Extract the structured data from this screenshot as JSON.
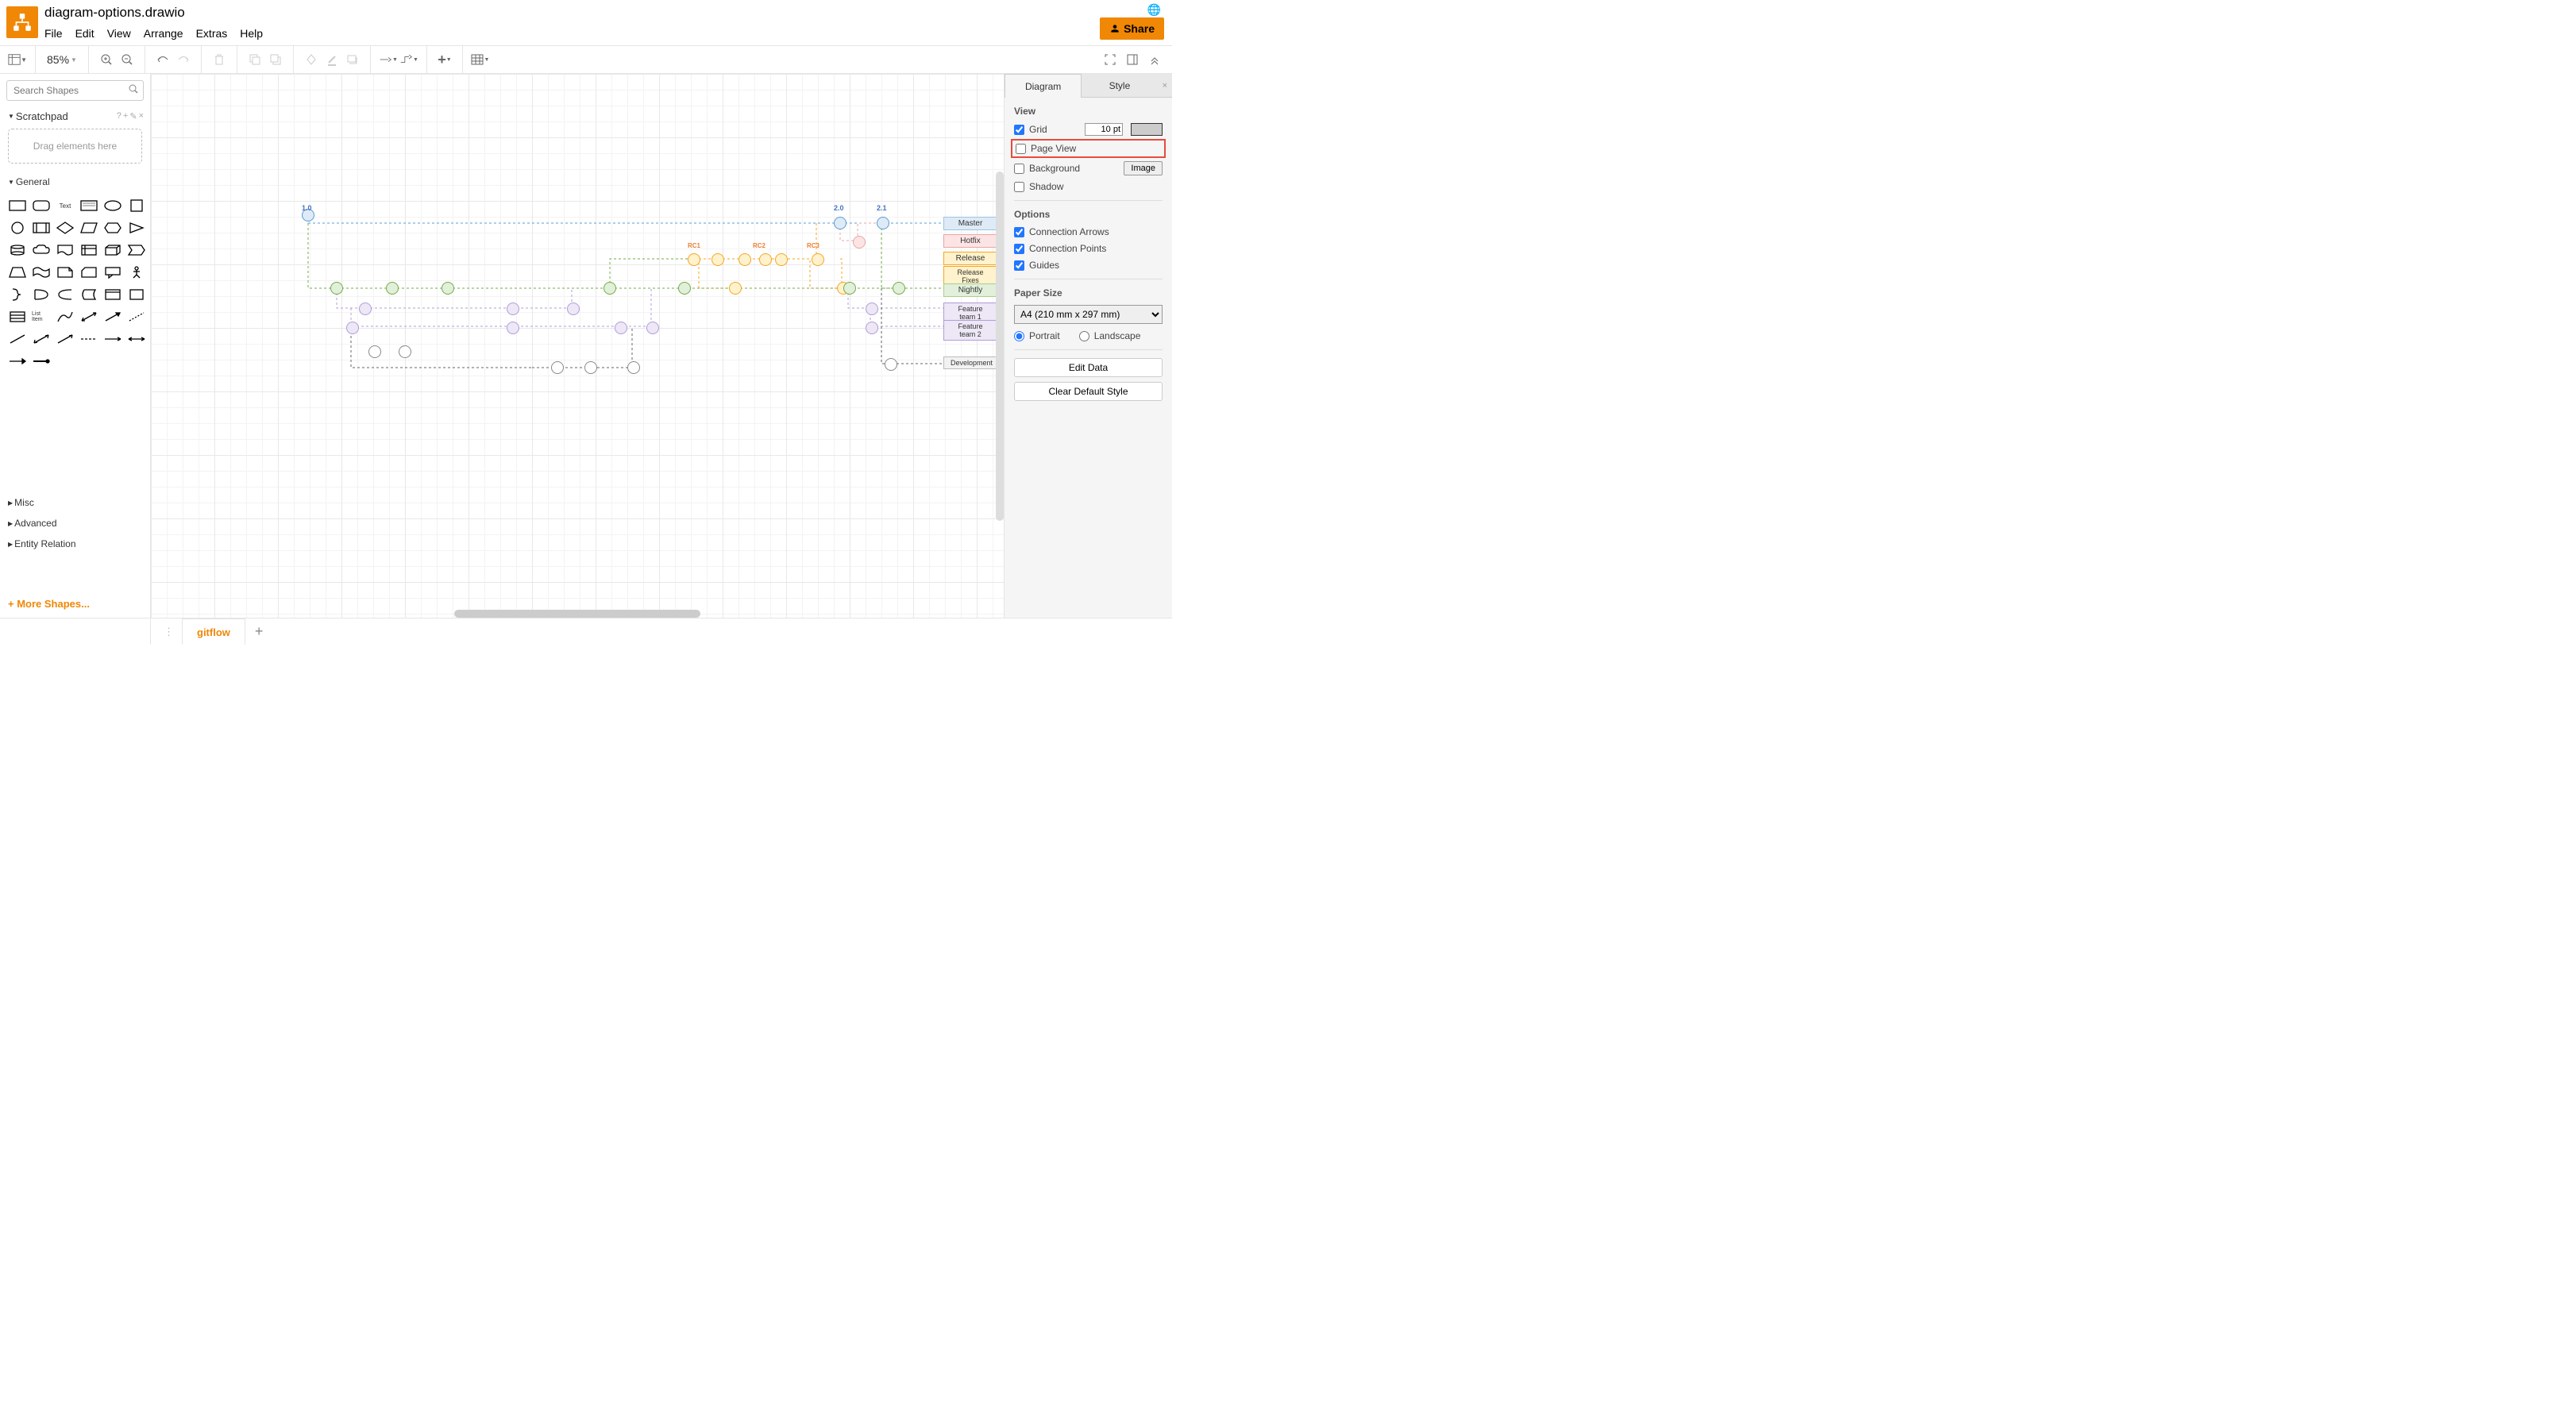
{
  "filename": "diagram-options.drawio",
  "menubar": [
    "File",
    "Edit",
    "View",
    "Arrange",
    "Extras",
    "Help"
  ],
  "share_label": "Share",
  "zoom": "85%",
  "search_placeholder": "Search Shapes",
  "scratchpad": {
    "title": "Scratchpad",
    "hint": "Drag elements here"
  },
  "shape_sections": {
    "general": "General",
    "misc": "Misc",
    "advanced": "Advanced",
    "entity": "Entity Relation"
  },
  "more_shapes": "+ More Shapes...",
  "page_tab": "gitflow",
  "right_tabs": {
    "diagram": "Diagram",
    "style": "Style"
  },
  "panel": {
    "view_title": "View",
    "grid": "Grid",
    "grid_value": "10 pt",
    "page_view": "Page View",
    "background": "Background",
    "image_btn": "Image",
    "shadow": "Shadow",
    "options_title": "Options",
    "conn_arrows": "Connection Arrows",
    "conn_points": "Connection Points",
    "guides": "Guides",
    "paper_title": "Paper Size",
    "paper_value": "A4 (210 mm x 297 mm)",
    "portrait": "Portrait",
    "landscape": "Landscape",
    "edit_data": "Edit Data",
    "clear_style": "Clear Default Style"
  },
  "diagram": {
    "versions": {
      "v1": "1.0",
      "v2": "2.0",
      "v3": "2.1"
    },
    "rc": {
      "rc1": "RC1",
      "rc2": "RC2",
      "rc3": "RC3"
    },
    "lanes": {
      "master": "Master",
      "hotfix": "Hotfix",
      "release": "Release",
      "release_fixes": "Release Fixes",
      "nightly": "Nightly",
      "feature1": "Feature team 1",
      "feature2": "Feature team 2",
      "development": "Development"
    }
  },
  "shape_text_label": "Text",
  "shape_listitem_label": "List Item"
}
